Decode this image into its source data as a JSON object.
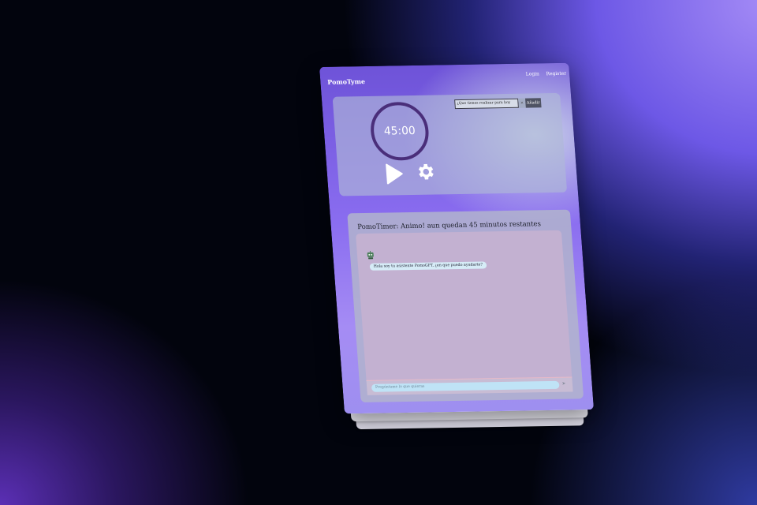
{
  "app": {
    "brand": "PomoTyme"
  },
  "auth": {
    "login_label": "Login",
    "register_label": "Register"
  },
  "timer": {
    "display": "45:00",
    "play_icon": "play-icon",
    "settings_icon": "gear-icon",
    "ring_color": "#4a2e7a"
  },
  "task": {
    "value": "¿Que tienes realizar para hoy",
    "clear_label": "×",
    "add_label": "Añadir"
  },
  "chat": {
    "title": "PomoTimer: Animo! aun quedan 45 minutos restantes",
    "bot_avatar_icon": "robot-icon",
    "messages": [
      {
        "text": "Hola soy tu asistente PomoGPT, ¿en que puedo ayudarte?"
      }
    ],
    "input_placeholder": "Pregúntame lo que quieras",
    "send_icon": "send-icon"
  },
  "colors": {
    "accent": "#6e53d8",
    "bubble": "#d6ecf7",
    "add_button": "#4f5363"
  }
}
